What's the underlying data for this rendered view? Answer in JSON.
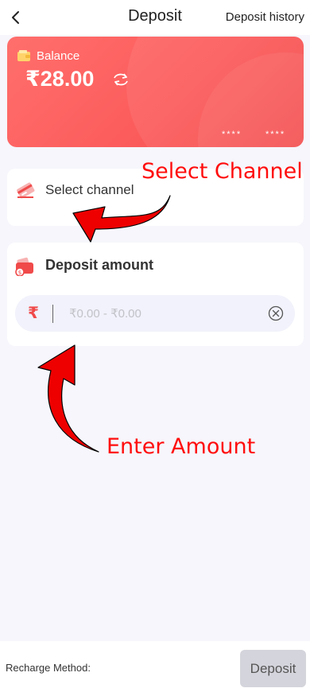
{
  "header": {
    "title": "Deposit",
    "history_link": "Deposit history"
  },
  "balance": {
    "label": "Balance",
    "amount": "₹28.00",
    "masked_group_1": "****",
    "masked_group_2": "****"
  },
  "channel": {
    "label": "Select channel"
  },
  "amount": {
    "title": "Deposit amount",
    "currency_symbol": "₹",
    "placeholder": "₹0.00 - ₹0.00",
    "value": ""
  },
  "annotations": {
    "select_channel": "Select Channel",
    "enter_amount": "Enter Amount"
  },
  "footer": {
    "recharge_method_label": "Recharge Method:",
    "deposit_button": "Deposit"
  },
  "colors": {
    "accent": "#f04a4a",
    "card_gradient_start": "#ff6f6c",
    "card_gradient_end": "#f4494a",
    "annotation": "#ff0d0d",
    "disabled_button": "#d4d4dc",
    "page_background": "#f6f6fc"
  },
  "icons": {
    "back": "chevron-left-icon",
    "wallet": "wallet-icon",
    "refresh": "refresh-icon",
    "channel": "card-icon",
    "amount": "wallet-coin-icon",
    "clear": "clear-circle-icon"
  }
}
